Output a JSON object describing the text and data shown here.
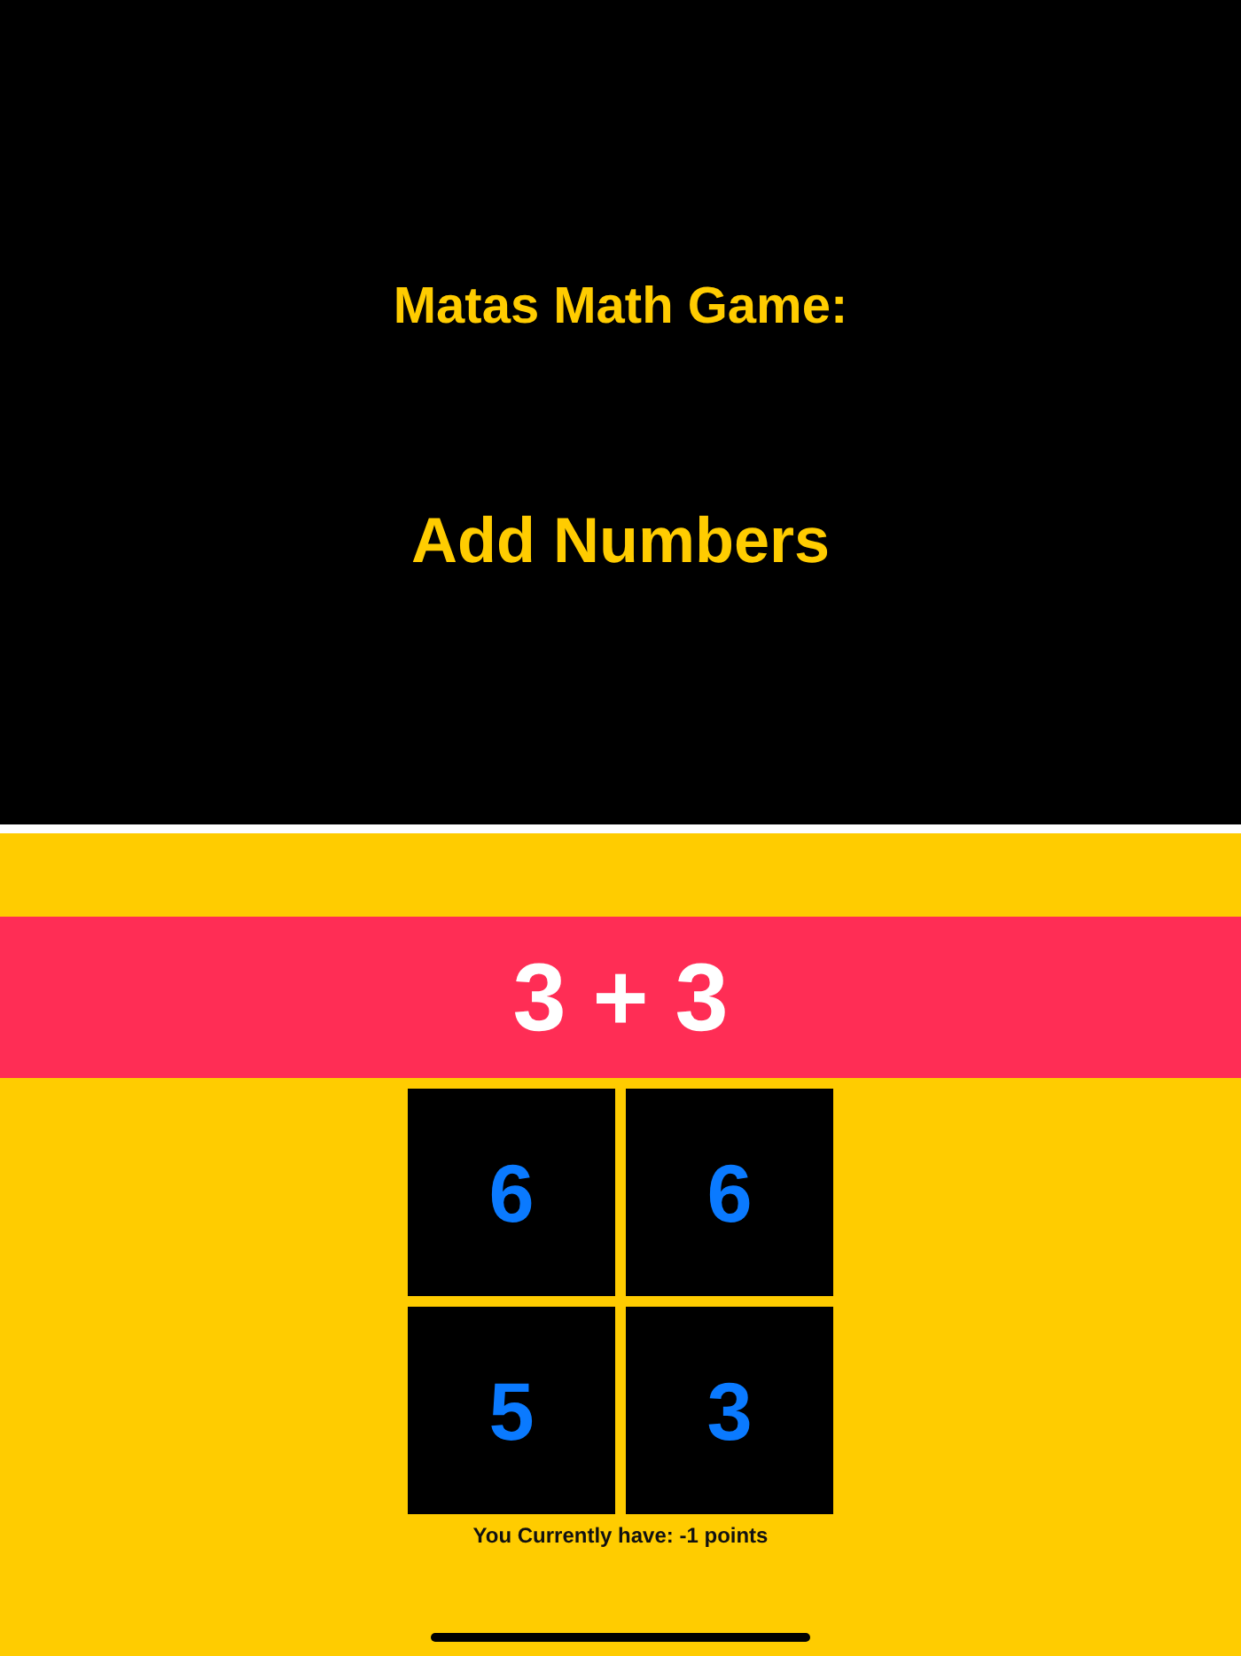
{
  "header": {
    "title": "Matas Math Game:",
    "subtitle": "Add Numbers"
  },
  "question": "3 + 3",
  "answers": [
    {
      "label": "6"
    },
    {
      "label": "6"
    },
    {
      "label": "5"
    },
    {
      "label": "3"
    }
  ],
  "score": "You Currently have: -1 points"
}
